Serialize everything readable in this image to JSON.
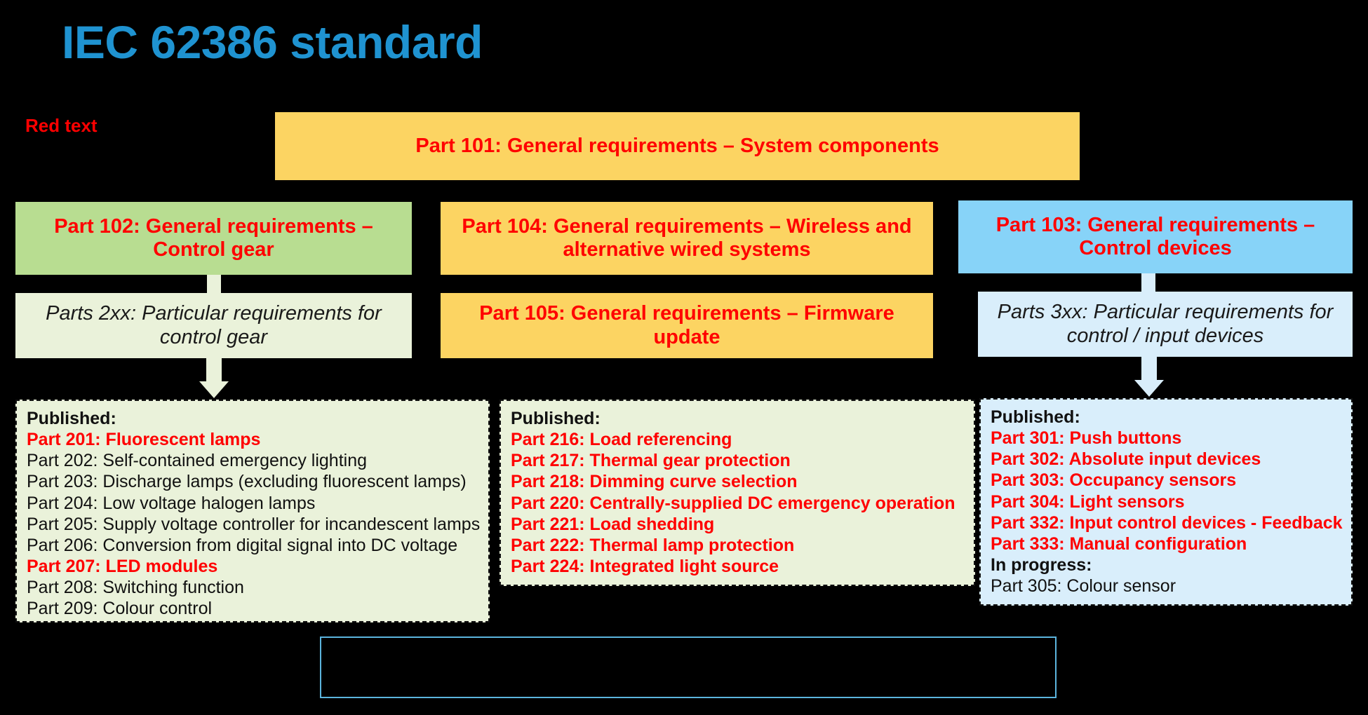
{
  "title": "IEC 62386 standard",
  "legend": {
    "red_text_label": "Red text"
  },
  "colors": {
    "title": "#1f93d1",
    "red": "#ff0000",
    "yellow_fill": "#fcd462",
    "green_fill": "#b8dd91",
    "blue_fill": "#87d3f8",
    "pale_green_fill": "#eaf2da",
    "pale_blue_fill": "#d9eefb",
    "outline_blue": "#5bb4dd",
    "background": "#000000"
  },
  "boxes": {
    "part101": "Part 101: General requirements – System components",
    "part102": "Part 102: General requirements – Control gear",
    "part104": "Part 104: General requirements – Wireless and alternative wired systems",
    "part103": "Part 103: General requirements – Control devices",
    "parts2xx": "Parts 2xx: Particular requirements for control gear",
    "part105": "Part 105: General requirements – Firmware update",
    "parts3xx": "Parts 3xx: Particular requirements for control / input devices"
  },
  "lists": {
    "control_gear": [
      {
        "text": "Published:",
        "style": "hdr"
      },
      {
        "text": "Part 201: Fluorescent lamps",
        "style": "red"
      },
      {
        "text": "Part 202: Self-contained emergency lighting",
        "style": "normal"
      },
      {
        "text": "Part 203: Discharge lamps (excluding fluorescent lamps)",
        "style": "normal"
      },
      {
        "text": "Part 204: Low voltage halogen lamps",
        "style": "normal"
      },
      {
        "text": "Part 205: Supply voltage controller for incandescent lamps",
        "style": "normal"
      },
      {
        "text": "Part 206: Conversion from digital signal into DC voltage",
        "style": "normal"
      },
      {
        "text": "Part 207: LED modules",
        "style": "red"
      },
      {
        "text": "Part 208: Switching function",
        "style": "normal"
      },
      {
        "text": "Part 209: Colour control",
        "style": "normal"
      }
    ],
    "features": [
      {
        "text": "Published:",
        "style": "hdr"
      },
      {
        "text": "Part 216: Load referencing",
        "style": "red"
      },
      {
        "text": "Part 217: Thermal gear protection",
        "style": "red"
      },
      {
        "text": "Part 218: Dimming curve selection",
        "style": "red"
      },
      {
        "text": "Part 220: Centrally-supplied DC emergency operation",
        "style": "red"
      },
      {
        "text": "Part 221: Load shedding",
        "style": "red"
      },
      {
        "text": "Part 222: Thermal lamp protection",
        "style": "red"
      },
      {
        "text": "Part 224: Integrated light source",
        "style": "red"
      }
    ],
    "control_devices": [
      {
        "text": "Published:",
        "style": "hdr"
      },
      {
        "text": "Part 301: Push buttons",
        "style": "red"
      },
      {
        "text": "Part 302: Absolute input devices",
        "style": "red"
      },
      {
        "text": "Part 303: Occupancy sensors",
        "style": "red"
      },
      {
        "text": "Part 304: Light sensors",
        "style": "red"
      },
      {
        "text": "Part 332: Input control devices - Feedback",
        "style": "red"
      },
      {
        "text": "Part 333: Manual configuration",
        "style": "red"
      },
      {
        "text": "In progress:",
        "style": "hdr"
      },
      {
        "text": "Part 305: Colour sensor",
        "style": "normal"
      }
    ]
  },
  "empty_note_box": {
    "text": ""
  }
}
